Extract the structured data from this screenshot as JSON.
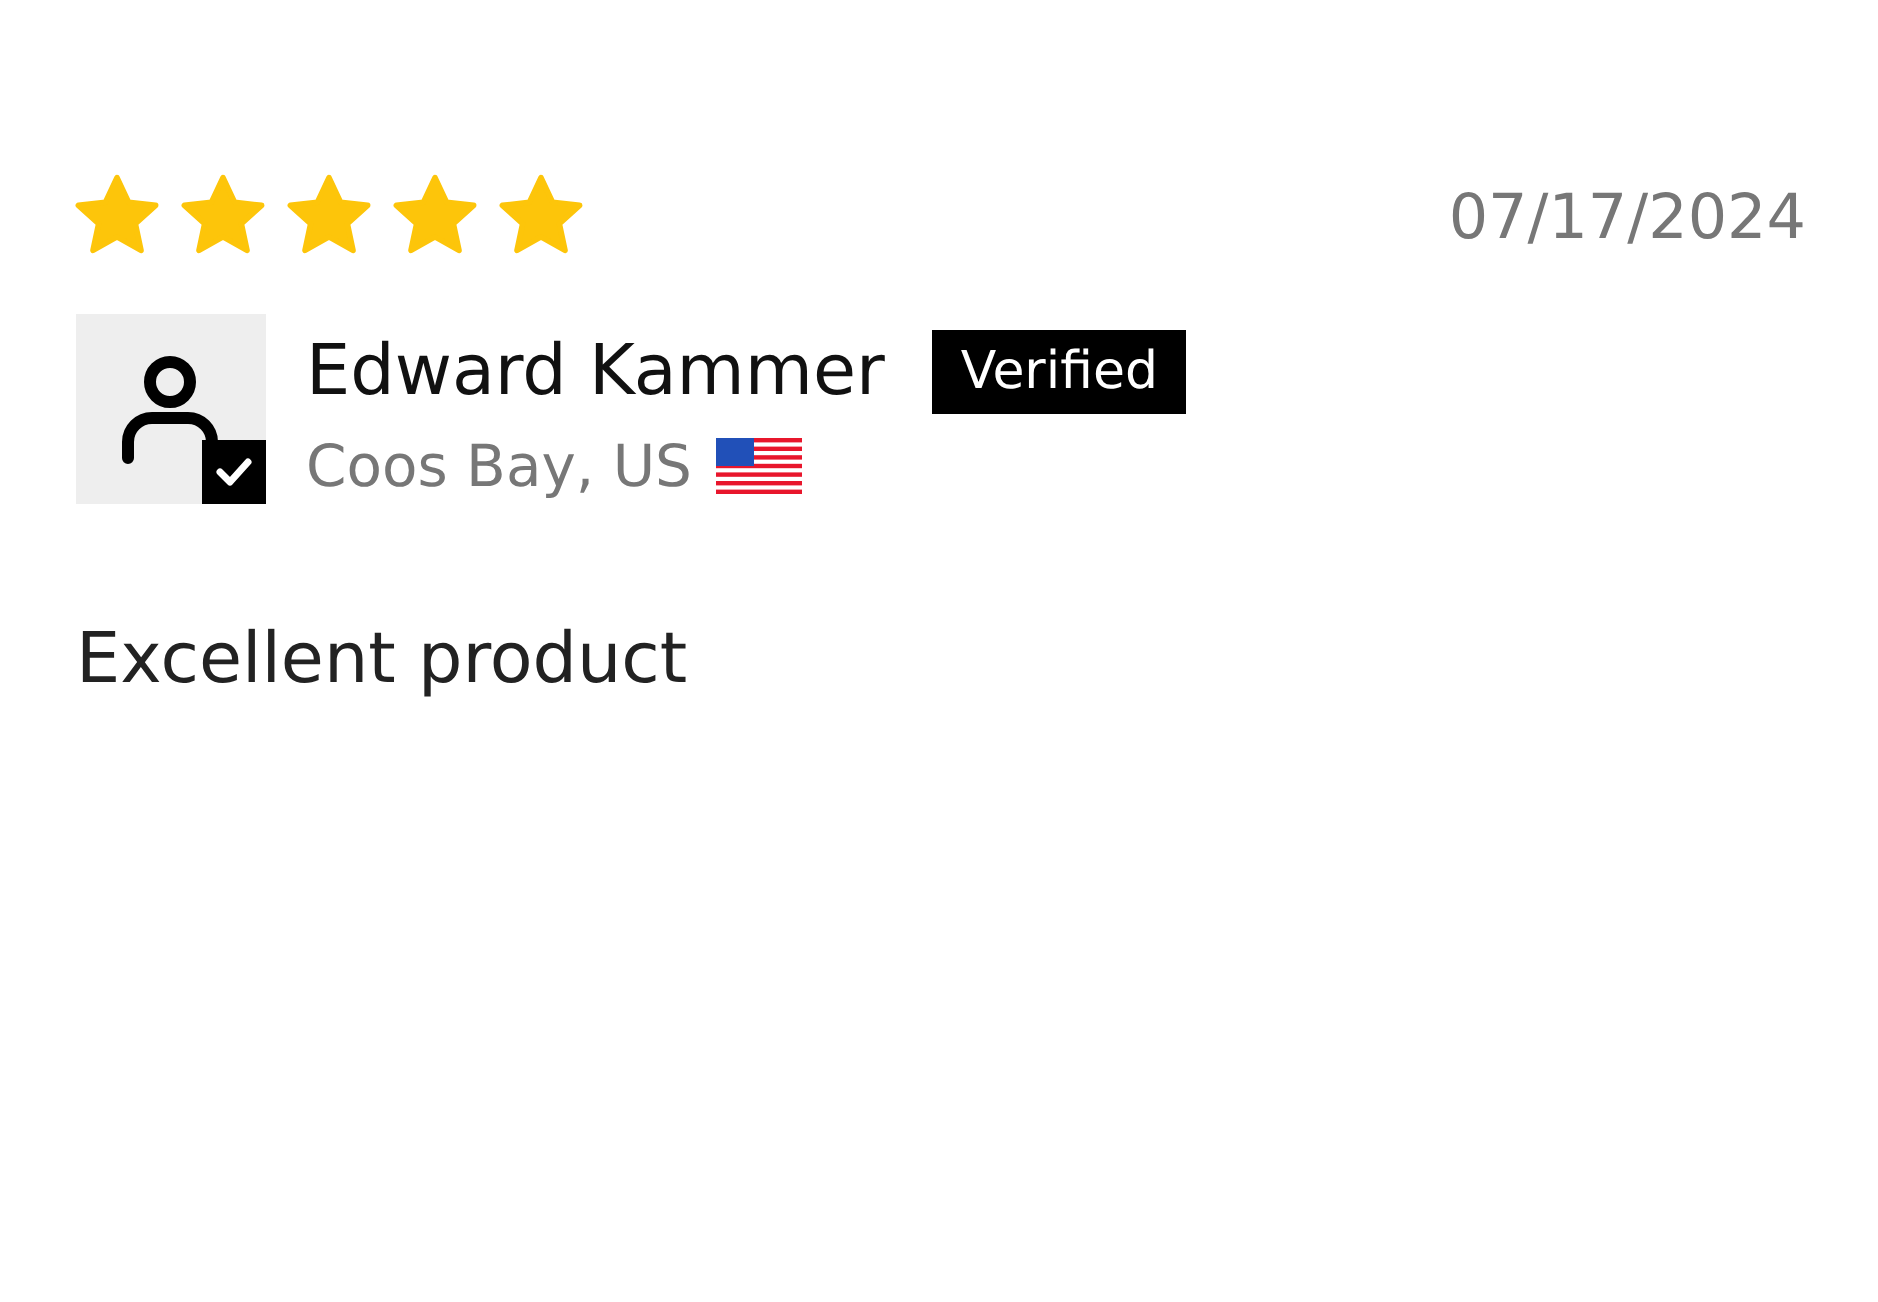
{
  "review": {
    "stars": 5,
    "date": "07/17/2024",
    "reviewer": {
      "name": "Edward Kammer",
      "verified": true,
      "badge": "Verified",
      "location": "Coos Bay, US"
    },
    "body": "Excellent product"
  }
}
